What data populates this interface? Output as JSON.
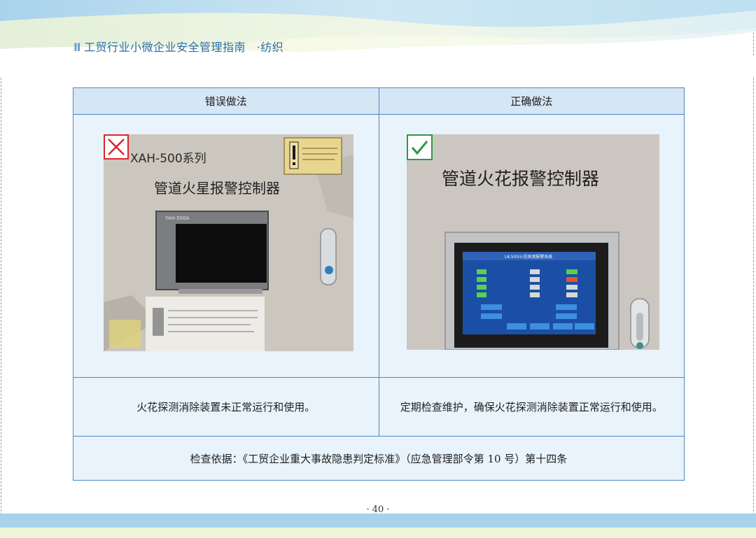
{
  "header": {
    "mark": "Ⅱ",
    "title": "工贸行业小微企业安全管理指南",
    "section": "·纺织"
  },
  "table": {
    "col_wrong": "错误做法",
    "col_right": "正确做法",
    "wrong_photo": {
      "series": "XAH-500系列",
      "device_title": "管道火星报警控制器",
      "panel_model": "YAH-500A"
    },
    "right_photo": {
      "device_title": "管道火花报警控制器",
      "screen_title": "LK-500火花探测报警系统"
    },
    "wrong_desc": "火花探测消除装置未正常运行和使用。",
    "right_desc": "定期检查维护，确保火花探测消除装置正常运行和使用。",
    "basis": "检查依据：《工贸企业重大事故隐患判定标准》（应急管理部令第 10 号）第十四条"
  },
  "page_number": "· 40 ·",
  "icons": {
    "wrong": "cross-icon",
    "right": "check-icon"
  },
  "colors": {
    "border": "#4f86c6",
    "header_fill": "#d5e6f5",
    "cell_fill": "#e9f3fb",
    "title": "#2e6da8",
    "cross": "#d8262b",
    "check": "#2e9a3c"
  }
}
